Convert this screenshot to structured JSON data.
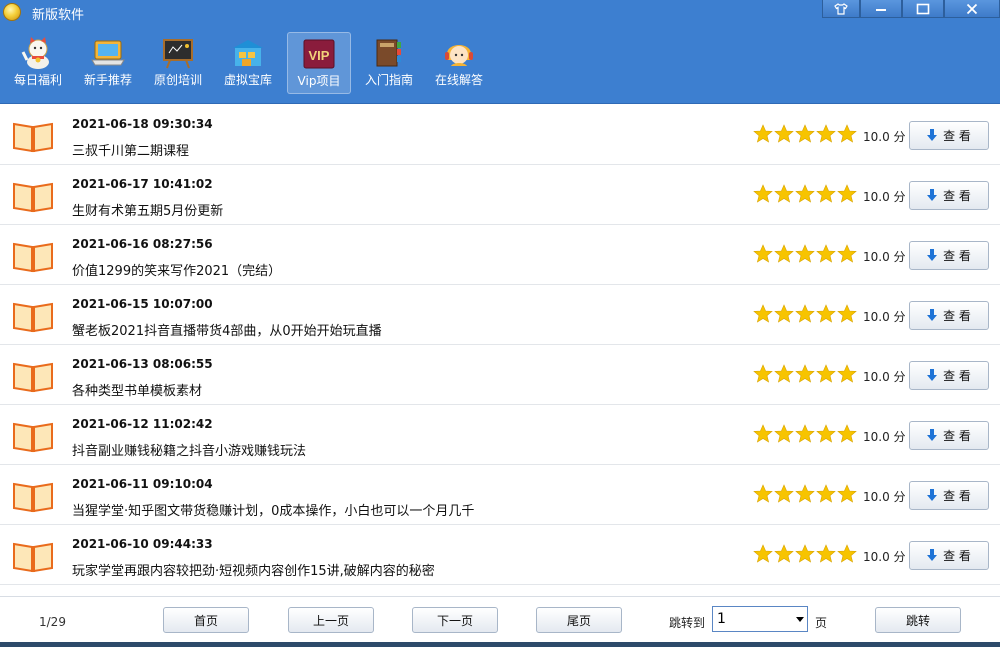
{
  "window": {
    "title": "新版软件",
    "skin_icon": "tshirt-icon",
    "minimize_icon": "minimize-icon",
    "maximize_icon": "maximize-icon",
    "close_icon": "close-icon"
  },
  "toolbar": {
    "items": [
      {
        "label": "每日福利",
        "icon": "lucky-cat-icon"
      },
      {
        "label": "新手推荐",
        "icon": "laptop-icon"
      },
      {
        "label": "原创培训",
        "icon": "blackboard-icon"
      },
      {
        "label": "虚拟宝库",
        "icon": "warehouse-icon"
      },
      {
        "label": "Vip项目",
        "icon": "vip-icon",
        "active": true,
        "badge": "VIP"
      },
      {
        "label": "入门指南",
        "icon": "book-guide-icon"
      },
      {
        "label": "在线解答",
        "icon": "support-agent-icon"
      }
    ]
  },
  "list": {
    "rating_max": 5,
    "items": [
      {
        "date": "2021-06-18 09:30:34",
        "title": "三叔千川第二期课程",
        "rating": 5,
        "score": "10.0 分",
        "action": "查 看"
      },
      {
        "date": "2021-06-17 10:41:02",
        "title": "生财有术第五期5月份更新",
        "rating": 5,
        "score": "10.0 分",
        "action": "查 看"
      },
      {
        "date": "2021-06-16 08:27:56",
        "title": "价值1299的笑来写作2021（完结）",
        "rating": 5,
        "score": "10.0 分",
        "action": "查 看"
      },
      {
        "date": "2021-06-15 10:07:00",
        "title": "蟹老板2021抖音直播带货4部曲，从0开始开始玩直播",
        "rating": 5,
        "score": "10.0 分",
        "action": "查 看"
      },
      {
        "date": "2021-06-13 08:06:55",
        "title": "各种类型书单模板素材",
        "rating": 5,
        "score": "10.0 分",
        "action": "查 看"
      },
      {
        "date": "2021-06-12 11:02:42",
        "title": "抖音副业赚钱秘籍之抖音小游戏赚钱玩法",
        "rating": 5,
        "score": "10.0 分",
        "action": "查 看"
      },
      {
        "date": "2021-06-11 09:10:04",
        "title": "当猩学堂·知乎图文带货稳赚计划，0成本操作，小白也可以一个月几千",
        "rating": 5,
        "score": "10.0 分",
        "action": "查 看"
      },
      {
        "date": "2021-06-10 09:44:33",
        "title": "玩家学堂再跟内容较把劲·短视频内容创作15讲,破解内容的秘密",
        "rating": 5,
        "score": "10.0 分",
        "action": "查 看"
      }
    ]
  },
  "pager": {
    "page_count": "1/29",
    "first": "首页",
    "prev": "上一页",
    "next": "下一页",
    "last": "尾页",
    "jump_label": "跳转到",
    "jump_value": "1",
    "page_suffix": "页",
    "jump_button": "跳转"
  },
  "colors": {
    "header_blue": "#3d7fd0",
    "star": "#f7c400",
    "download_arrow": "#1e73d6"
  }
}
